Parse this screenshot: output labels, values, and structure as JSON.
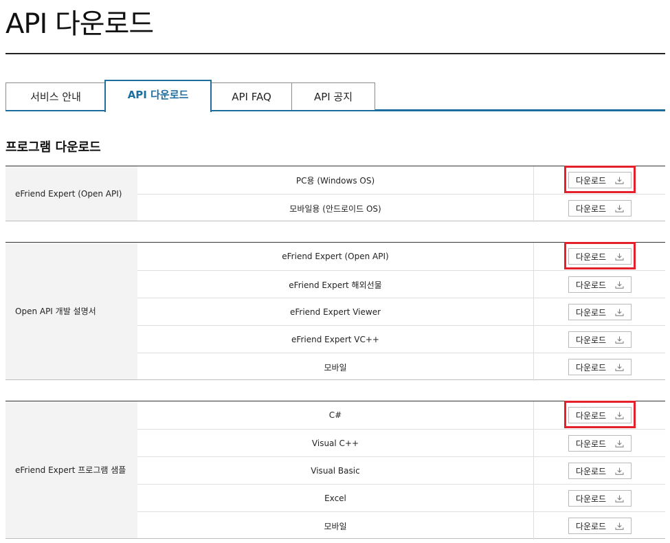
{
  "page": {
    "title": "API 다운로드"
  },
  "tabs": [
    {
      "label": "서비스 안내",
      "active": false
    },
    {
      "label": "API 다운로드",
      "active": true
    },
    {
      "label": "API FAQ",
      "active": false
    },
    {
      "label": "API 공지",
      "active": false
    }
  ],
  "section": {
    "title": "프로그램 다운로드"
  },
  "download_label": "다운로드",
  "groups": [
    {
      "label": "eFriend Expert (Open API)",
      "rows": [
        {
          "name": "PC용 (Windows OS)",
          "highlighted": true
        },
        {
          "name": "모바일용 (안드로이드 OS)",
          "highlighted": false
        }
      ]
    },
    {
      "label": "Open API 개발 설명서",
      "rows": [
        {
          "name": "eFriend Expert (Open API)",
          "highlighted": true
        },
        {
          "name": "eFriend Expert 해외선물",
          "highlighted": false
        },
        {
          "name": "eFriend Expert Viewer",
          "highlighted": false
        },
        {
          "name": "eFriend Expert VC++",
          "highlighted": false
        },
        {
          "name": "모바일",
          "highlighted": false
        }
      ]
    },
    {
      "label": "eFriend Expert 프로그램 샘플",
      "rows": [
        {
          "name": "C#",
          "highlighted": true
        },
        {
          "name": "Visual C++",
          "highlighted": false
        },
        {
          "name": "Visual Basic",
          "highlighted": false
        },
        {
          "name": "Excel",
          "highlighted": false
        },
        {
          "name": "모바일",
          "highlighted": false
        }
      ]
    }
  ],
  "colors": {
    "accent": "#1d6e9f",
    "highlight": "#e5202a",
    "label_bg": "#f3f3f3"
  },
  "icons": {
    "download": "download-icon"
  }
}
